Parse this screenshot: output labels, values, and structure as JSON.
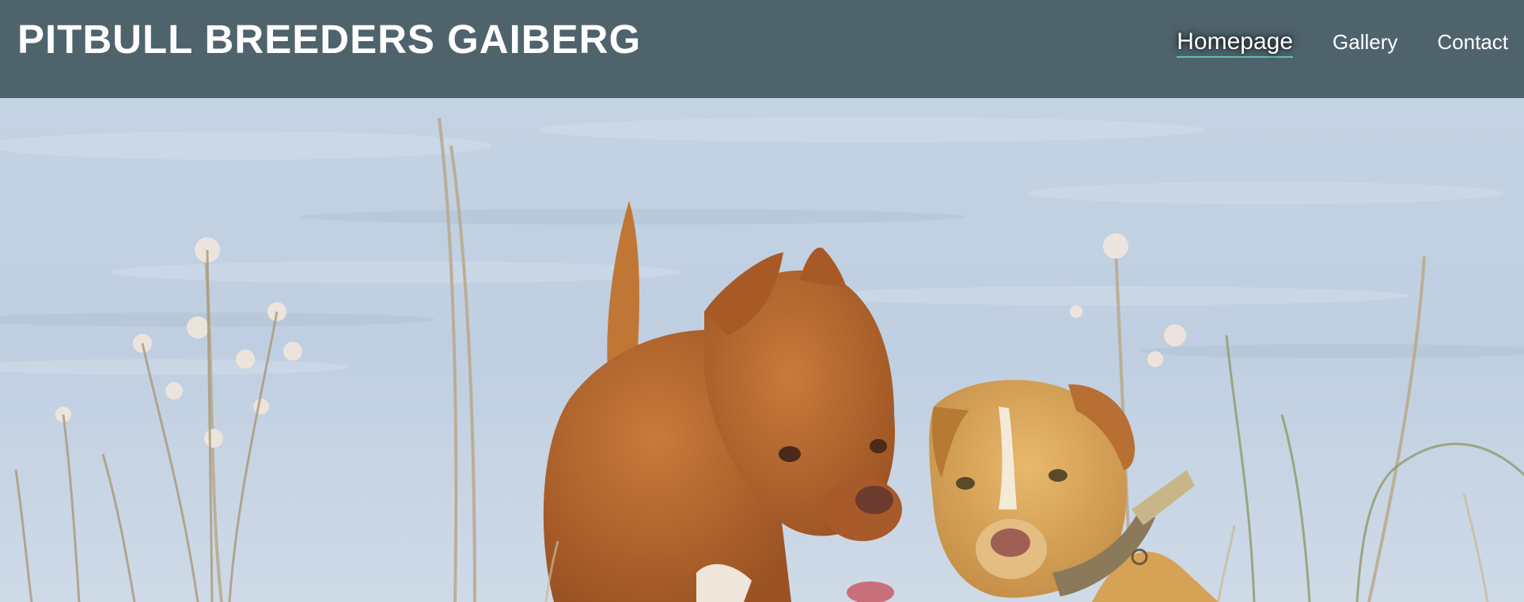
{
  "header": {
    "title": "PITBULL BREEDERS GAIBERG",
    "background_color": "#4f636d",
    "text_color": "#ffffff",
    "active_underline_color": "#5fc4b0"
  },
  "nav": {
    "items": [
      {
        "label": "Homepage",
        "active": true
      },
      {
        "label": "Gallery",
        "active": false
      },
      {
        "label": "Contact",
        "active": false
      }
    ]
  },
  "hero": {
    "image_subject": "two-pitbull-dogs-in-grass-photo",
    "sky_color": "#c9d7e6",
    "dog_left_color": "#b7652a",
    "dog_right_color": "#d9a25a"
  }
}
